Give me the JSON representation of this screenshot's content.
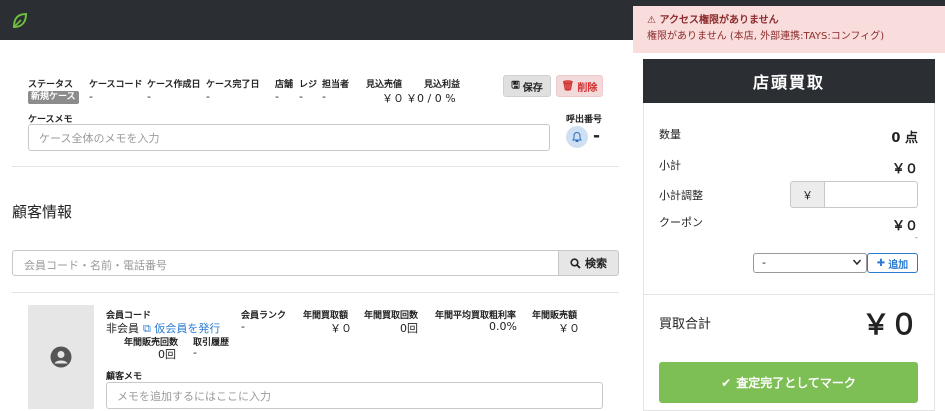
{
  "alert": {
    "title": "アクセス権限がありません",
    "message": "権限がありません (本店, 外部連携:TAYS:コンフィグ)"
  },
  "case": {
    "labels": {
      "status": "ステータス",
      "case_code": "ケースコード",
      "created": "ケース作成日",
      "completed": "ケース完了日",
      "store": "店舗",
      "register": "レジ",
      "staff": "担当者",
      "expected_sales": "見込売値",
      "expected_profit": "見込利益",
      "memo": "ケースメモ",
      "call_number": "呼出番号"
    },
    "status_badge": "新規ケース",
    "values": {
      "case_code": "-",
      "created": "-",
      "completed": "-",
      "store": "-",
      "register": "-",
      "staff": "-",
      "expected_sales": "￥０",
      "expected_profit": "￥0 / 0 %"
    },
    "memo_placeholder": "ケース全体のメモを入力",
    "call_number_value": "-",
    "save_label": "保存",
    "delete_label": "削除"
  },
  "customer": {
    "heading": "顧客情報",
    "search_placeholder": "会員コード・名前・電話番号",
    "search_button": "検索",
    "member_code_label": "会員コード",
    "member_value": "非会員",
    "issue_temp_link": "仮会員を発行",
    "rank_label": "会員ランク",
    "rank_value": "-",
    "annual_buy_amount_label": "年間買取額",
    "annual_buy_amount_value": "￥０",
    "annual_buy_count_label": "年間買取回数",
    "annual_buy_count_value": "0回",
    "annual_margin_label": "年間平均買取粗利率",
    "annual_margin_value": "0.0%",
    "annual_sales_amount_label": "年間販売額",
    "annual_sales_amount_value": "￥０",
    "annual_sales_count_label": "年間販売回数",
    "annual_sales_count_value": "0回",
    "history_label": "取引履歴",
    "history_value": "-",
    "memo_label": "顧客メモ",
    "memo_placeholder": "メモを追加するにはここに入力"
  },
  "side": {
    "title": "店頭買取",
    "quantity_label": "数量",
    "quantity_value": "0 点",
    "subtotal_label": "小計",
    "subtotal_value": "￥０",
    "adjust_label": "小計調整",
    "adjust_currency": "￥",
    "adjust_value": "",
    "coupon_label": "クーポン",
    "coupon_value": "￥０",
    "coupon_sub": "-",
    "coupon_select": "-",
    "add_label": "追加",
    "total_label": "買取合計",
    "total_value": "￥０",
    "done_label": "査定完了としてマーク"
  },
  "colors": {
    "topbar": "#2b2e33",
    "accent_green": "#7dbe55",
    "link_blue": "#2b7bd1",
    "danger": "#d12f2f"
  }
}
